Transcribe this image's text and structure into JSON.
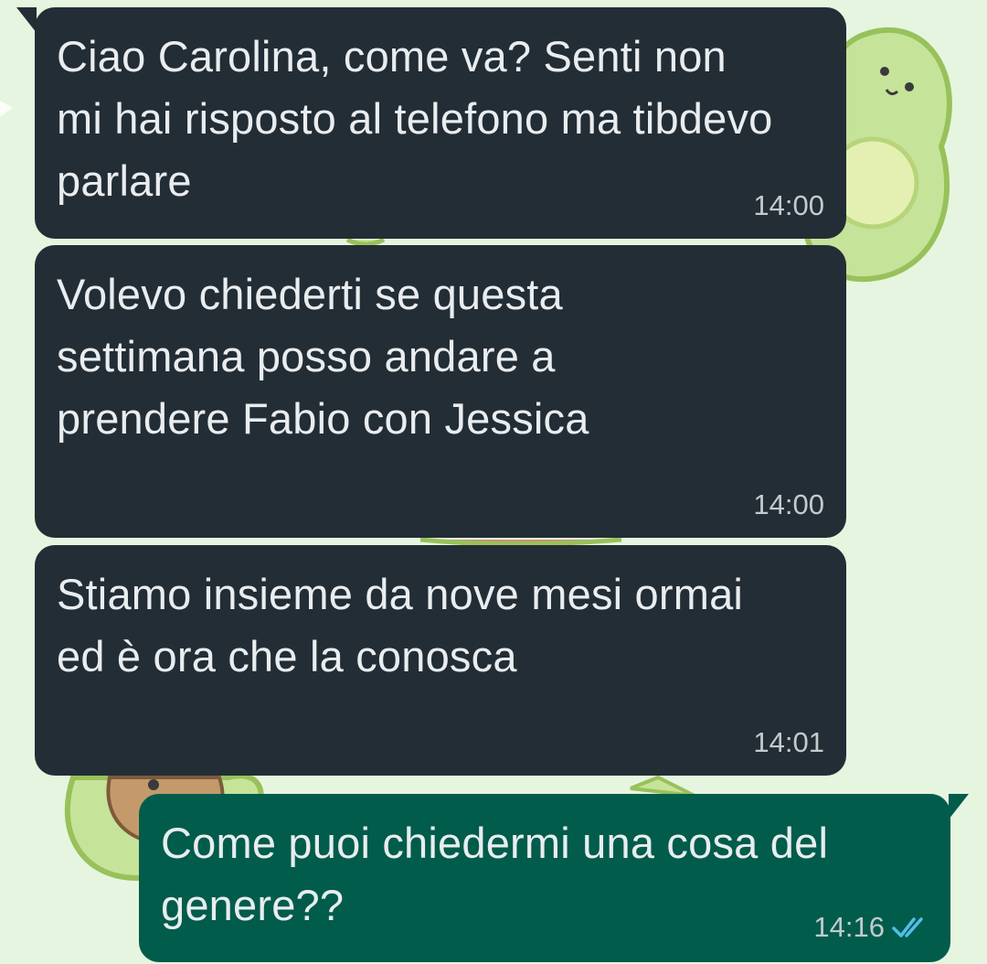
{
  "colors": {
    "wallpaper": "#e6f5df",
    "incoming_bubble": "#232d36",
    "outgoing_bubble": "#015c4b",
    "message_text": "#e9edef",
    "timestamp_text": "#c4cacd",
    "read_ticks": "#53bdeb"
  },
  "messages": [
    {
      "direction": "incoming",
      "text": "Ciao Carolina, come va? Senti non mi hai risposto al telefono ma tibdevo parlare",
      "time": "14:00"
    },
    {
      "direction": "incoming",
      "text": "Volevo chiederti se questa settimana posso andare a prendere Fabio con Jessica",
      "time": "14:00"
    },
    {
      "direction": "incoming",
      "text": "Stiamo insieme da nove mesi ormai ed è ora che la conosca",
      "time": "14:01"
    },
    {
      "direction": "outgoing",
      "text": "Come puoi chiedermi una cosa del genere??",
      "time": "14:16",
      "status_icon": "double-check-read-icon"
    }
  ]
}
